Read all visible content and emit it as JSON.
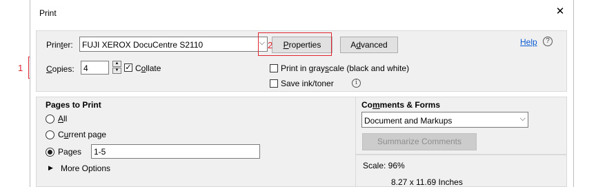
{
  "dialog": {
    "title": "Print",
    "close_glyph": "✕"
  },
  "printer": {
    "label_pre": "Prin",
    "label_key": "t",
    "label_post": "er:",
    "value": "FUJI XEROX DocuCentre S2110"
  },
  "buttons": {
    "properties_key": "P",
    "properties_rest": "roperties",
    "advanced_pre": "A",
    "advanced_key": "d",
    "advanced_rest": "vanced"
  },
  "help": {
    "label": "Help",
    "icon": "question-icon"
  },
  "copies": {
    "label_key": "C",
    "label_rest": "opies:",
    "value": "4"
  },
  "collate": {
    "label_pre": "C",
    "label_key": "o",
    "label_rest": "llate",
    "checked": true,
    "mark": "✓"
  },
  "grayscale": {
    "label_pre": "Print in gray",
    "label_key": "s",
    "label_rest": "cale (black and white)",
    "checked": false
  },
  "save_ink": {
    "label": "Save ink/toner",
    "checked": false,
    "info_glyph": "i"
  },
  "pages_to_print": {
    "heading": "Pages to Print",
    "all_key": "A",
    "all_rest": "ll",
    "current_pre": "C",
    "current_key": "u",
    "current_rest": "rrent page",
    "pages_pre": "Pa",
    "pages_key": "g",
    "pages_rest": "es",
    "pages_value": "1-5",
    "selected": "pages",
    "more_options": "More Options",
    "more_glyph": "▶"
  },
  "comments_forms": {
    "heading_pre": "Co",
    "heading_key": "m",
    "heading_rest": "ments & Forms",
    "value": "Document and Markups",
    "summarize": "Summarize Comments"
  },
  "scale": {
    "text": "Scale:  96%",
    "paper_size": "8.27 x 11.69 Inches"
  },
  "annotations": [
    {
      "number": "1"
    },
    {
      "number": "2"
    }
  ],
  "colors": {
    "annotation_red": "#e0242f",
    "panel_bg": "#f0f0f0"
  },
  "arrow_glyph": "⌵"
}
